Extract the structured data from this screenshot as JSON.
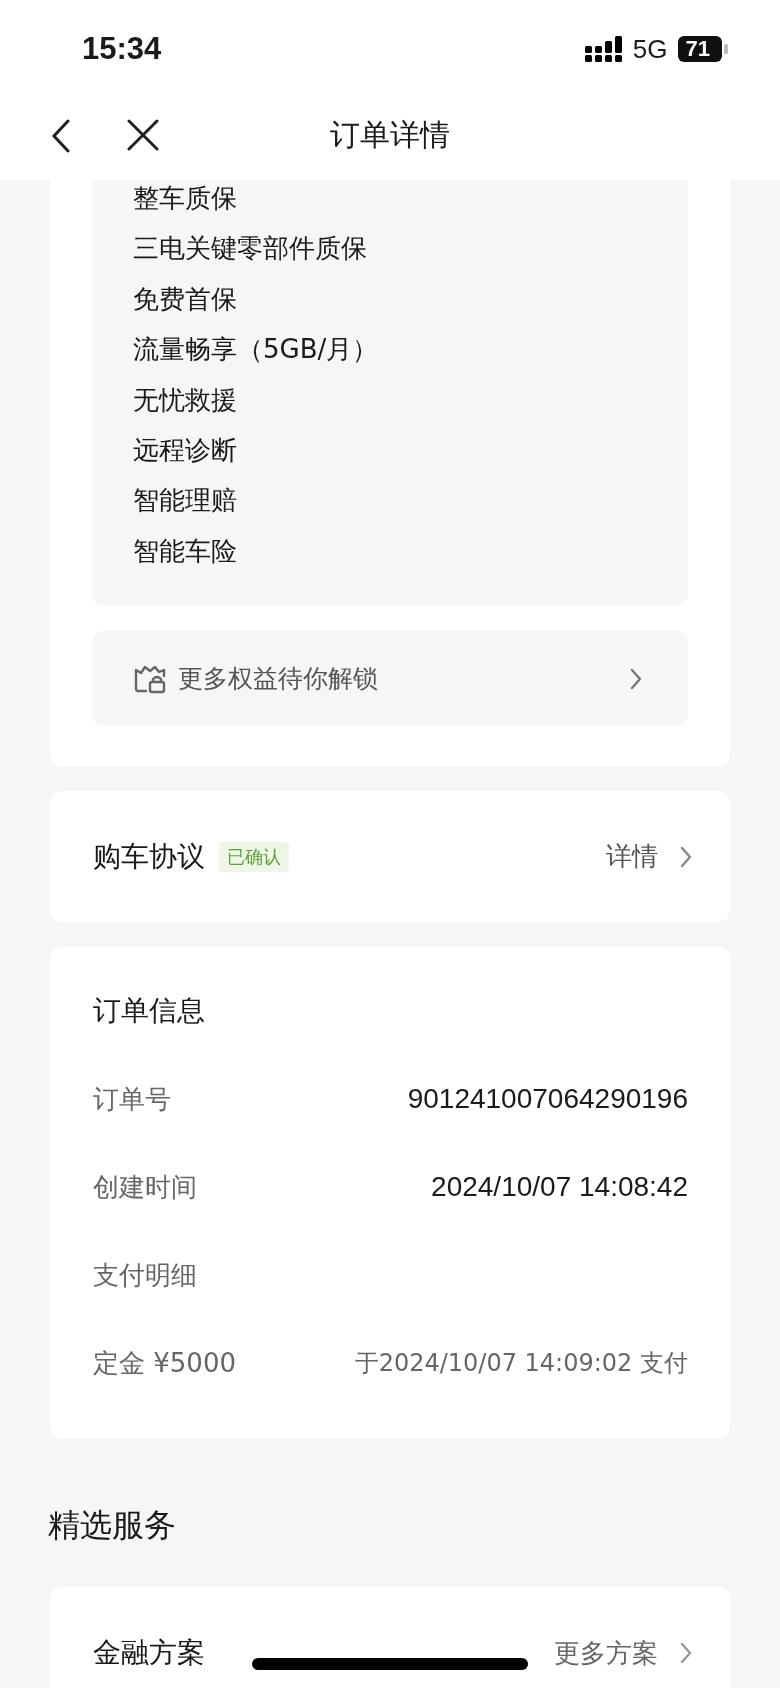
{
  "status_bar": {
    "time": "15:34",
    "network": "5G",
    "battery": "71"
  },
  "nav_bar": {
    "title": "订单详情"
  },
  "benefits": {
    "items": [
      "整车质保",
      "三电关键零部件质保",
      "免费首保",
      "流量畅享（5GB/月）",
      "无忧救援",
      "远程诊断",
      "智能理赔",
      "智能车险"
    ],
    "unlock": {
      "label": "更多权益待你解锁"
    }
  },
  "agreement": {
    "title": "购车协议",
    "badge": "已确认",
    "link": "详情"
  },
  "order_info": {
    "rows": [
      {
        "kind": "heading",
        "label": "订单信息"
      },
      {
        "kind": "field",
        "label": "订单号",
        "value": "901241007064290196"
      },
      {
        "kind": "field",
        "label": "创建时间",
        "value": "2024/10/07 14:08:42"
      },
      {
        "kind": "subheading",
        "label": "支付明细"
      },
      {
        "kind": "payment",
        "label": "定金 ¥5000",
        "value": "于2024/10/07 14:09:02 支付"
      }
    ]
  },
  "featured_services": {
    "title": "精选服务",
    "finance": {
      "title": "金融方案",
      "link": "更多方案"
    }
  }
}
